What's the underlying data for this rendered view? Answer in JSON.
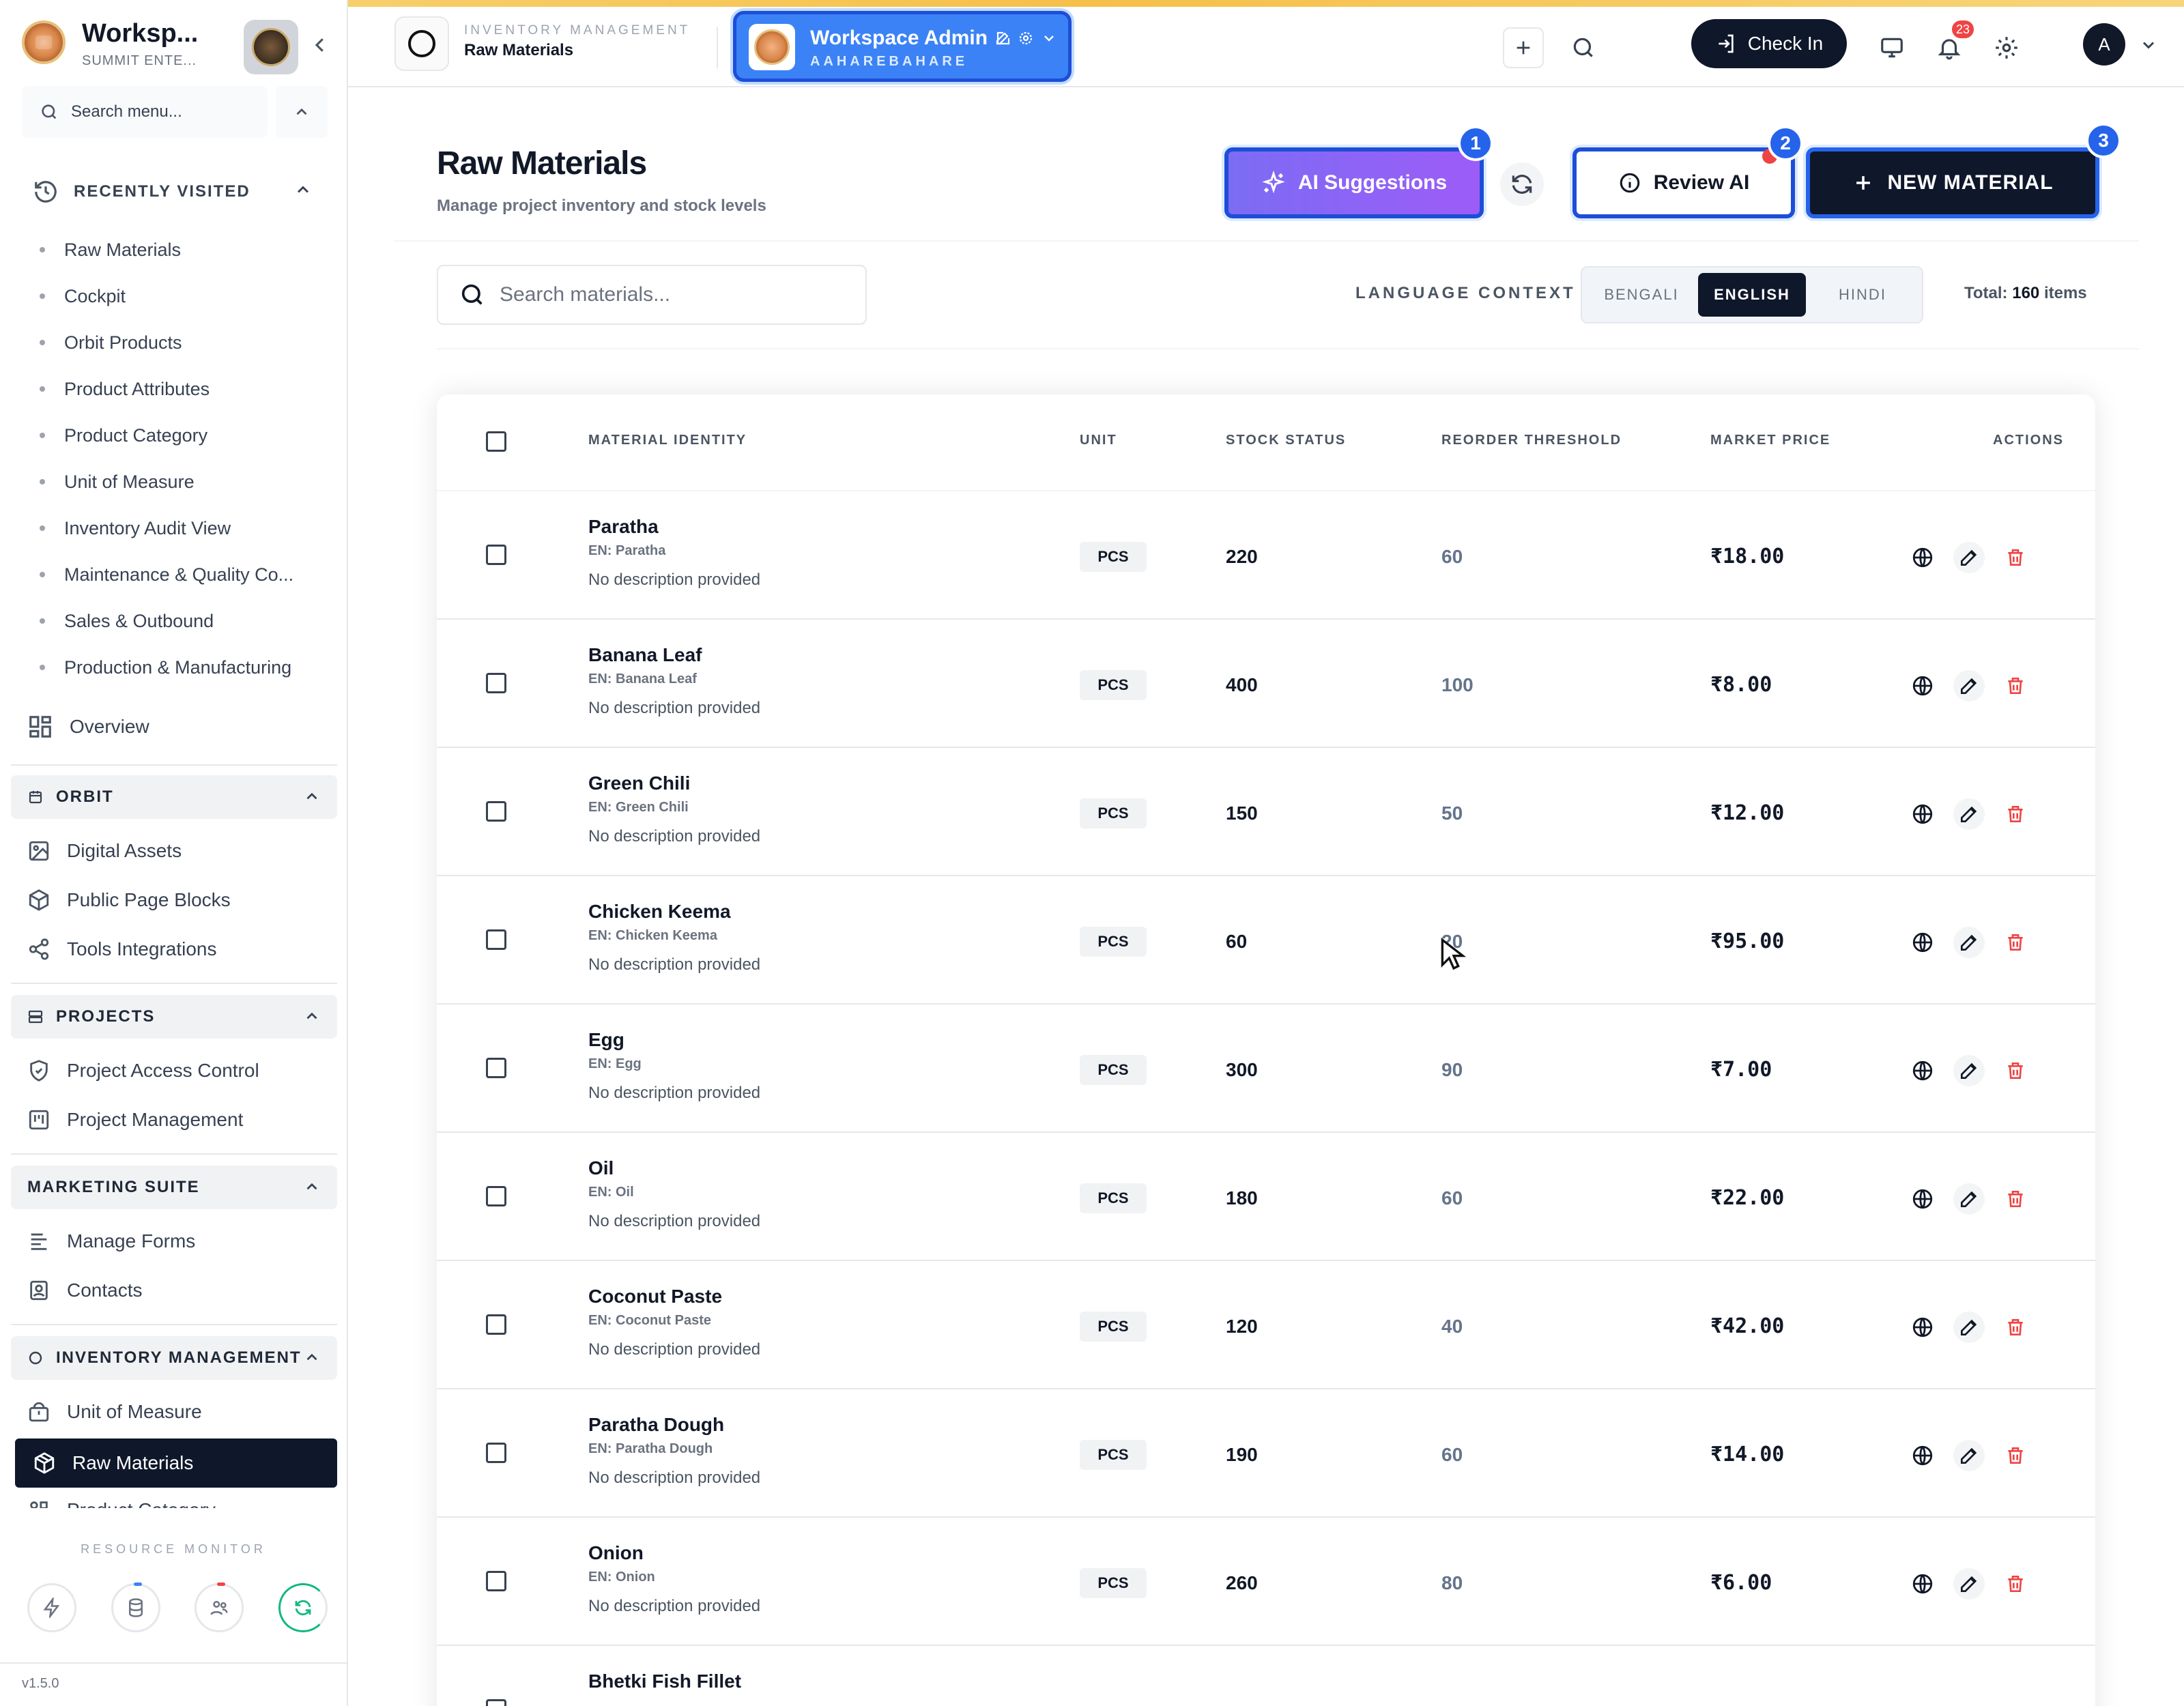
{
  "sidebar": {
    "title": "Worksp...",
    "subtitle": "SUMMIT ENTE...",
    "search_placeholder": "Search menu...",
    "recent_label": "RECENTLY VISITED",
    "recent": [
      "Raw Materials",
      "Cockpit",
      "Orbit Products",
      "Product Attributes",
      "Product Category",
      "Unit of Measure",
      "Inventory Audit View",
      "Maintenance & Quality Co...",
      "Sales & Outbound",
      "Production & Manufacturing"
    ],
    "overview": "Overview",
    "orbit": {
      "label": "ORBIT",
      "items": [
        "Digital Assets",
        "Public Page Blocks",
        "Tools Integrations"
      ]
    },
    "projects": {
      "label": "PROJECTS",
      "items": [
        "Project Access Control",
        "Project Management"
      ]
    },
    "marketing": {
      "label": "MARKETING SUITE",
      "items": [
        "Manage Forms",
        "Contacts"
      ]
    },
    "inventory": {
      "label": "INVENTORY MANAGEMENT",
      "items": [
        "Unit of Measure",
        "Raw Materials",
        "Product Category"
      ]
    },
    "resource_monitor": "RESOURCE MONITOR",
    "version": "v1.5.0"
  },
  "header": {
    "module_label": "INVENTORY MANAGEMENT",
    "module_page": "Raw Materials",
    "workspace_title": "Workspace Admin",
    "workspace_sub": "AAHAREBAHARE",
    "checkin": "Check In",
    "notifications": "23",
    "user_initial": "A"
  },
  "page": {
    "title": "Raw Materials",
    "subtitle": "Manage project inventory and stock levels",
    "ai_suggestions": "AI Suggestions",
    "review_ai": "Review AI",
    "new_material": "NEW MATERIAL",
    "badges": [
      "1",
      "2",
      "3"
    ],
    "search_placeholder": "Search materials...",
    "language_label": "LANGUAGE CONTEXT",
    "languages": [
      "BENGALI",
      "ENGLISH",
      "HINDI"
    ],
    "active_language": "ENGLISH",
    "total_prefix": "Total:",
    "total_count": "160",
    "total_suffix": "items"
  },
  "table": {
    "columns": [
      "MATERIAL IDENTITY",
      "UNIT",
      "STOCK STATUS",
      "REORDER THRESHOLD",
      "MARKET PRICE",
      "ACTIONS"
    ],
    "rows": [
      {
        "name": "Paratha",
        "en": "EN: Paratha",
        "desc": "No description provided",
        "unit": "PCS",
        "stock": "220",
        "threshold": "60",
        "price": "₹18.00"
      },
      {
        "name": "Banana Leaf",
        "en": "EN: Banana Leaf",
        "desc": "No description provided",
        "unit": "PCS",
        "stock": "400",
        "threshold": "100",
        "price": "₹8.00"
      },
      {
        "name": "Green Chili",
        "en": "EN: Green Chili",
        "desc": "No description provided",
        "unit": "PCS",
        "stock": "150",
        "threshold": "50",
        "price": "₹12.00"
      },
      {
        "name": "Chicken Keema",
        "en": "EN: Chicken Keema",
        "desc": "No description provided",
        "unit": "PCS",
        "stock": "60",
        "threshold": "20",
        "price": "₹95.00"
      },
      {
        "name": "Egg",
        "en": "EN: Egg",
        "desc": "No description provided",
        "unit": "PCS",
        "stock": "300",
        "threshold": "90",
        "price": "₹7.00"
      },
      {
        "name": "Oil",
        "en": "EN: Oil",
        "desc": "No description provided",
        "unit": "PCS",
        "stock": "180",
        "threshold": "60",
        "price": "₹22.00"
      },
      {
        "name": "Coconut Paste",
        "en": "EN: Coconut Paste",
        "desc": "No description provided",
        "unit": "PCS",
        "stock": "120",
        "threshold": "40",
        "price": "₹42.00"
      },
      {
        "name": "Paratha Dough",
        "en": "EN: Paratha Dough",
        "desc": "No description provided",
        "unit": "PCS",
        "stock": "190",
        "threshold": "60",
        "price": "₹14.00"
      },
      {
        "name": "Onion",
        "en": "EN: Onion",
        "desc": "No description provided",
        "unit": "PCS",
        "stock": "260",
        "threshold": "80",
        "price": "₹6.00"
      },
      {
        "name": "Bhetki Fish Fillet",
        "en": "",
        "desc": "",
        "unit": "",
        "stock": "",
        "threshold": "",
        "price": ""
      }
    ]
  },
  "colors": {
    "accent_blue": "#2563eb",
    "dark": "#0f172a",
    "danger": "#ef4444",
    "ai_purple": "#8b5cf6"
  },
  "icons": [
    "history-icon",
    "overview-grid-icon",
    "calendar-icon",
    "image-icon",
    "cube-icon",
    "share-icon",
    "server-icon",
    "shield-icon",
    "kanban-icon",
    "form-icon",
    "contact-icon",
    "circle-icon",
    "scale-icon",
    "package-icon",
    "bolt-icon",
    "database-icon",
    "users-icon",
    "refresh-icon",
    "plus-icon",
    "search-icon",
    "login-icon",
    "monitor-icon",
    "bell-icon",
    "gear-icon",
    "chevron-down-icon",
    "globe-icon",
    "pencil-icon",
    "trash-icon",
    "sparkles-icon",
    "info-icon"
  ]
}
